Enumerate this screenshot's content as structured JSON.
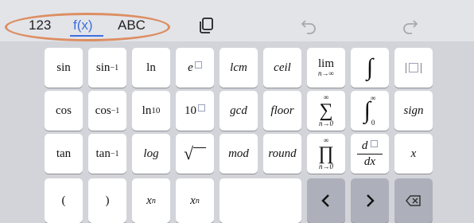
{
  "toolbar": {
    "tabs": [
      {
        "label": "123",
        "active": false
      },
      {
        "label": "f(x)",
        "active": true
      },
      {
        "label": "ABC",
        "active": false
      }
    ],
    "accent": "#3d6fe0",
    "ring_color": "#dc8e62",
    "icons": [
      "copy-icon",
      "undo-icon",
      "redo-icon"
    ]
  },
  "keys": {
    "sin": "sin",
    "asin": "sin",
    "asin_sup": "−1",
    "ln": "ln",
    "e": "e",
    "lcm": "lcm",
    "ceil": "ceil",
    "lim": "lim",
    "lim_sub": "n→∞",
    "integral": "∫",
    "abs_l": "|",
    "abs_r": "|",
    "cos": "cos",
    "acos": "cos",
    "acos_sup": "−1",
    "ln10": "ln",
    "ln10_sub": "10",
    "ten": "10",
    "gcd": "gcd",
    "floor": "floor",
    "sum": "∑",
    "sum_top": "∞",
    "sum_bot": "n→0",
    "dint": "∫",
    "dint_top": "∞",
    "dint_bot": "0",
    "sign": "sign",
    "tan": "tan",
    "atan": "tan",
    "atan_sup": "−1",
    "log": "log",
    "sqrt": "√",
    "mod": "mod",
    "round": "round",
    "prod": "∏",
    "prod_top": "∞",
    "prod_bot": "n→0",
    "deriv_d": "d",
    "deriv_dx": "dx",
    "x": "x",
    "lparen": "(",
    "rparen": ")",
    "xpow": "x",
    "xpow_sup": "n",
    "xsub": "x",
    "xsub_sub": "n",
    "left": "‹",
    "right": "›"
  }
}
